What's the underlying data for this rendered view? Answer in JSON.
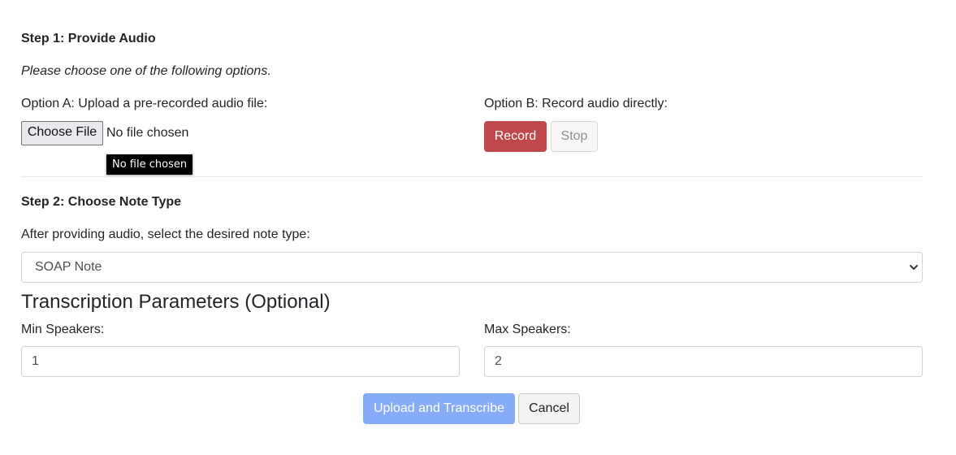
{
  "step1": {
    "heading": "Step 1: Provide Audio",
    "instruction": "Please choose one of the following options.",
    "option_a_label": "Option A: Upload a pre-recorded audio file:",
    "choose_file_label": "Choose File",
    "file_status": "No file chosen",
    "tooltip": "No file chosen",
    "option_b_label": "Option B: Record audio directly:",
    "record_label": "Record",
    "stop_label": "Stop"
  },
  "step2": {
    "heading": "Step 2: Choose Note Type",
    "instruction": "After providing audio, select the desired note type:",
    "selected_note_type": "SOAP Note"
  },
  "params": {
    "heading": "Transcription Parameters (Optional)",
    "min_label": "Min Speakers:",
    "min_value": "1",
    "max_label": "Max Speakers:",
    "max_value": "2"
  },
  "actions": {
    "upload_label": "Upload and Transcribe",
    "cancel_label": "Cancel"
  },
  "colors": {
    "record": "#c0484a",
    "upload_disabled": "#86acf8"
  },
  "icons": {
    "select_arrow": "chevron-down-icon"
  }
}
